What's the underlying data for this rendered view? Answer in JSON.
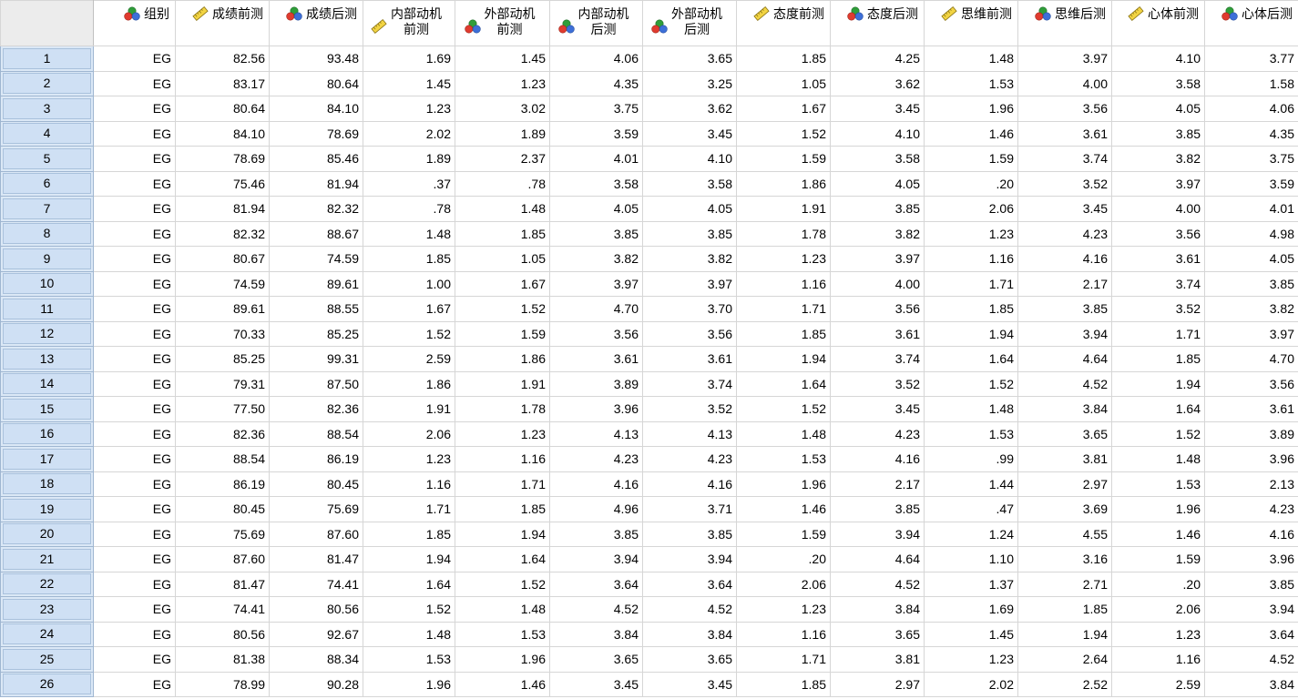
{
  "columns": [
    {
      "name": "组别",
      "icon": "nominal-icon"
    },
    {
      "name": "成绩前测",
      "icon": "scale-icon"
    },
    {
      "name": "成绩后测",
      "icon": "nominal-icon"
    },
    {
      "name": "内部动机前测",
      "line1": "内部动机",
      "line2": "前测",
      "icon": "scale-icon"
    },
    {
      "name": "外部动机前测",
      "line1": "外部动机",
      "line2": "前测",
      "icon": "nominal-icon"
    },
    {
      "name": "内部动机后测",
      "line1": "内部动机",
      "line2": "后测",
      "icon": "nominal-icon"
    },
    {
      "name": "外部动机后测",
      "line1": "外部动机",
      "line2": "后测",
      "icon": "nominal-icon"
    },
    {
      "name": "态度前测",
      "icon": "scale-icon"
    },
    {
      "name": "态度后测",
      "icon": "nominal-icon"
    },
    {
      "name": "思维前测",
      "icon": "scale-icon"
    },
    {
      "name": "思维后测",
      "icon": "nominal-icon"
    },
    {
      "name": "心体前测",
      "icon": "scale-icon"
    },
    {
      "name": "心体后测",
      "icon": "nominal-icon"
    }
  ],
  "rows": [
    [
      "1",
      "EG",
      "82.56",
      "93.48",
      "1.69",
      "1.45",
      "4.06",
      "3.65",
      "1.85",
      "4.25",
      "1.48",
      "3.97",
      "4.10",
      "3.77"
    ],
    [
      "2",
      "EG",
      "83.17",
      "80.64",
      "1.45",
      "1.23",
      "4.35",
      "3.25",
      "1.05",
      "3.62",
      "1.53",
      "4.00",
      "3.58",
      "1.58"
    ],
    [
      "3",
      "EG",
      "80.64",
      "84.10",
      "1.23",
      "3.02",
      "3.75",
      "3.62",
      "1.67",
      "3.45",
      "1.96",
      "3.56",
      "4.05",
      "4.06"
    ],
    [
      "4",
      "EG",
      "84.10",
      "78.69",
      "2.02",
      "1.89",
      "3.59",
      "3.45",
      "1.52",
      "4.10",
      "1.46",
      "3.61",
      "3.85",
      "4.35"
    ],
    [
      "5",
      "EG",
      "78.69",
      "85.46",
      "1.89",
      "2.37",
      "4.01",
      "4.10",
      "1.59",
      "3.58",
      "1.59",
      "3.74",
      "3.82",
      "3.75"
    ],
    [
      "6",
      "EG",
      "75.46",
      "81.94",
      ".37",
      ".78",
      "3.58",
      "3.58",
      "1.86",
      "4.05",
      ".20",
      "3.52",
      "3.97",
      "3.59"
    ],
    [
      "7",
      "EG",
      "81.94",
      "82.32",
      ".78",
      "1.48",
      "4.05",
      "4.05",
      "1.91",
      "3.85",
      "2.06",
      "3.45",
      "4.00",
      "4.01"
    ],
    [
      "8",
      "EG",
      "82.32",
      "88.67",
      "1.48",
      "1.85",
      "3.85",
      "3.85",
      "1.78",
      "3.82",
      "1.23",
      "4.23",
      "3.56",
      "4.98"
    ],
    [
      "9",
      "EG",
      "80.67",
      "74.59",
      "1.85",
      "1.05",
      "3.82",
      "3.82",
      "1.23",
      "3.97",
      "1.16",
      "4.16",
      "3.61",
      "4.05"
    ],
    [
      "10",
      "EG",
      "74.59",
      "89.61",
      "1.00",
      "1.67",
      "3.97",
      "3.97",
      "1.16",
      "4.00",
      "1.71",
      "2.17",
      "3.74",
      "3.85"
    ],
    [
      "11",
      "EG",
      "89.61",
      "88.55",
      "1.67",
      "1.52",
      "4.70",
      "3.70",
      "1.71",
      "3.56",
      "1.85",
      "3.85",
      "3.52",
      "3.82"
    ],
    [
      "12",
      "EG",
      "70.33",
      "85.25",
      "1.52",
      "1.59",
      "3.56",
      "3.56",
      "1.85",
      "3.61",
      "1.94",
      "3.94",
      "1.71",
      "3.97"
    ],
    [
      "13",
      "EG",
      "85.25",
      "99.31",
      "2.59",
      "1.86",
      "3.61",
      "3.61",
      "1.94",
      "3.74",
      "1.64",
      "4.64",
      "1.85",
      "4.70"
    ],
    [
      "14",
      "EG",
      "79.31",
      "87.50",
      "1.86",
      "1.91",
      "3.89",
      "3.74",
      "1.64",
      "3.52",
      "1.52",
      "4.52",
      "1.94",
      "3.56"
    ],
    [
      "15",
      "EG",
      "77.50",
      "82.36",
      "1.91",
      "1.78",
      "3.96",
      "3.52",
      "1.52",
      "3.45",
      "1.48",
      "3.84",
      "1.64",
      "3.61"
    ],
    [
      "16",
      "EG",
      "82.36",
      "88.54",
      "2.06",
      "1.23",
      "4.13",
      "4.13",
      "1.48",
      "4.23",
      "1.53",
      "3.65",
      "1.52",
      "3.89"
    ],
    [
      "17",
      "EG",
      "88.54",
      "86.19",
      "1.23",
      "1.16",
      "4.23",
      "4.23",
      "1.53",
      "4.16",
      ".99",
      "3.81",
      "1.48",
      "3.96"
    ],
    [
      "18",
      "EG",
      "86.19",
      "80.45",
      "1.16",
      "1.71",
      "4.16",
      "4.16",
      "1.96",
      "2.17",
      "1.44",
      "2.97",
      "1.53",
      "2.13"
    ],
    [
      "19",
      "EG",
      "80.45",
      "75.69",
      "1.71",
      "1.85",
      "4.96",
      "3.71",
      "1.46",
      "3.85",
      ".47",
      "3.69",
      "1.96",
      "4.23"
    ],
    [
      "20",
      "EG",
      "75.69",
      "87.60",
      "1.85",
      "1.94",
      "3.85",
      "3.85",
      "1.59",
      "3.94",
      "1.24",
      "4.55",
      "1.46",
      "4.16"
    ],
    [
      "21",
      "EG",
      "87.60",
      "81.47",
      "1.94",
      "1.64",
      "3.94",
      "3.94",
      ".20",
      "4.64",
      "1.10",
      "3.16",
      "1.59",
      "3.96"
    ],
    [
      "22",
      "EG",
      "81.47",
      "74.41",
      "1.64",
      "1.52",
      "3.64",
      "3.64",
      "2.06",
      "4.52",
      "1.37",
      "2.71",
      ".20",
      "3.85"
    ],
    [
      "23",
      "EG",
      "74.41",
      "80.56",
      "1.52",
      "1.48",
      "4.52",
      "4.52",
      "1.23",
      "3.84",
      "1.69",
      "1.85",
      "2.06",
      "3.94"
    ],
    [
      "24",
      "EG",
      "80.56",
      "92.67",
      "1.48",
      "1.53",
      "3.84",
      "3.84",
      "1.16",
      "3.65",
      "1.45",
      "1.94",
      "1.23",
      "3.64"
    ],
    [
      "25",
      "EG",
      "81.38",
      "88.34",
      "1.53",
      "1.96",
      "3.65",
      "3.65",
      "1.71",
      "3.81",
      "1.23",
      "2.64",
      "1.16",
      "4.52"
    ],
    [
      "26",
      "EG",
      "78.99",
      "90.28",
      "1.96",
      "1.46",
      "3.45",
      "3.45",
      "1.85",
      "2.97",
      "2.02",
      "2.52",
      "2.59",
      "3.84"
    ]
  ],
  "colors": {
    "rowHeader": "#cfe0f4",
    "grid": "#d6d6d6"
  }
}
